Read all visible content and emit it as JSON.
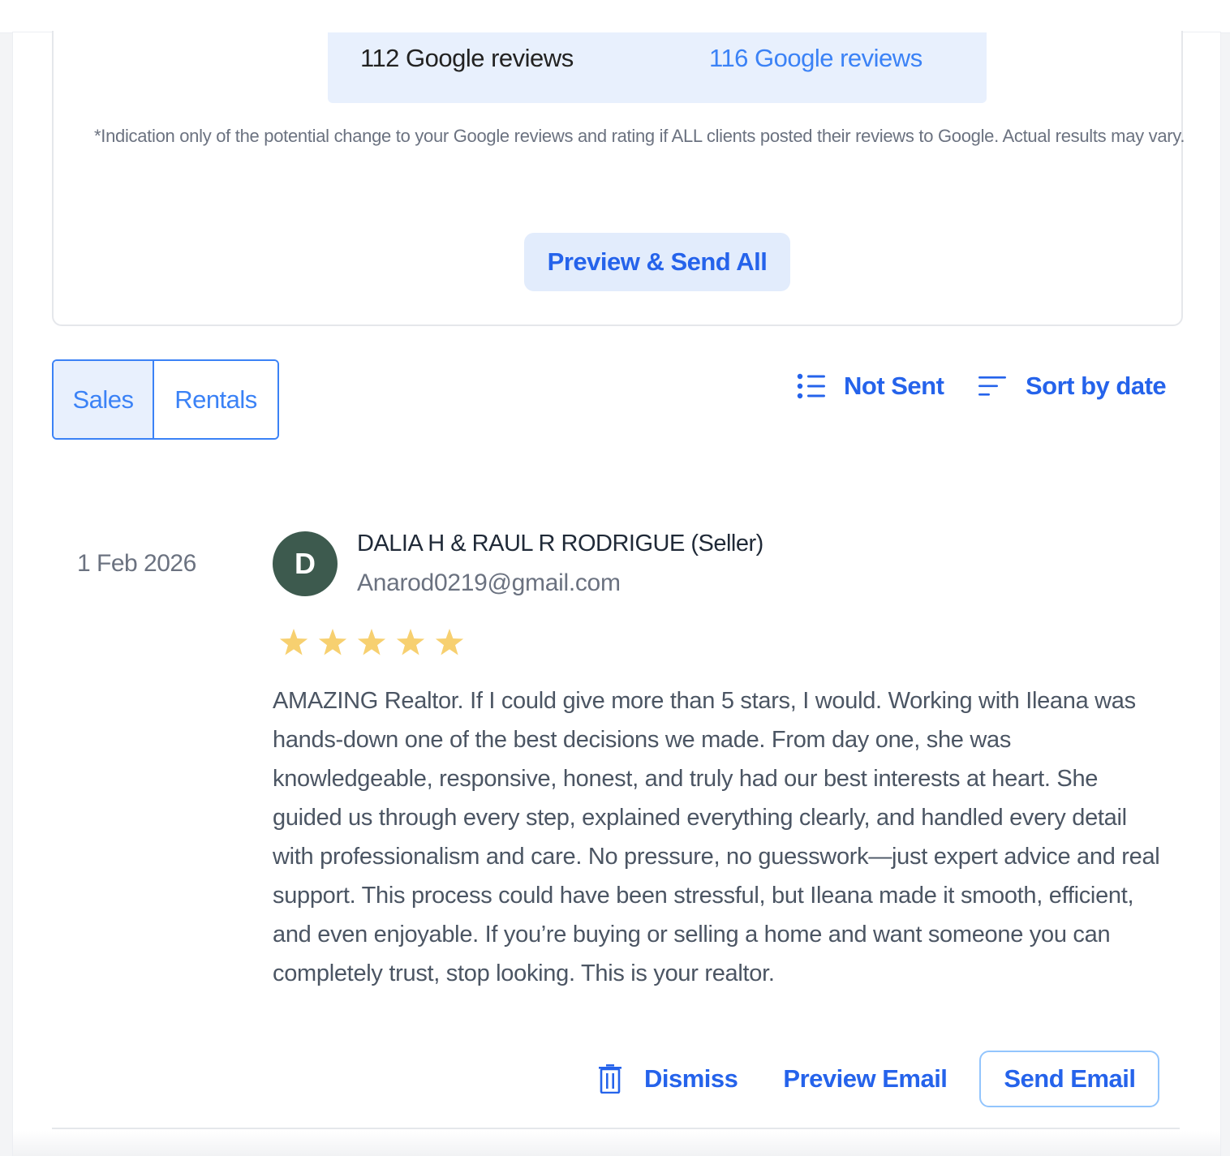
{
  "summary": {
    "current_reviews": "112 Google reviews",
    "potential_reviews": "116 Google reviews",
    "disclaimer": "*Indication only of the potential change to your Google reviews and rating if ALL clients posted their reviews to Google. Actual results may vary.",
    "preview_send_all_label": "Preview & Send All"
  },
  "tabs": {
    "items": [
      {
        "label": "Sales",
        "active": true
      },
      {
        "label": "Rentals",
        "active": false
      }
    ]
  },
  "filters": {
    "status_label": "Not Sent",
    "status_icon": "list-icon",
    "sort_label": "Sort by date",
    "sort_icon": "sort-icon"
  },
  "review": {
    "date": "1 Feb 2026",
    "avatar_initial": "D",
    "avatar_color": "#3d5a4e",
    "name": "DALIA H & RAUL R RODRIGUE (Seller)",
    "email": "Anarod0219@gmail.com",
    "rating": 5,
    "rating_max": 5,
    "star_color": "#f7d070",
    "text": "AMAZING Realtor. If I could give more than 5 stars, I would. Working with Ileana was hands-down one of the best decisions we made. From day one, she was knowledgeable, responsive, honest, and truly had our best interests at heart. She guided us through every step, explained everything clearly, and handled every detail with professionalism and care. No pressure, no guesswork—just expert advice and real support. This process could have been stressful, but Ileana made it smooth, efficient, and even enjoyable. If you’re buying or selling a home and want someone you can completely trust, stop looking. This is your realtor.",
    "actions": {
      "dismiss_label": "Dismiss",
      "dismiss_icon": "trash-icon",
      "preview_label": "Preview Email",
      "send_label": "Send Email"
    }
  },
  "colors": {
    "accent": "#2563eb",
    "accent_light": "#3b82f6",
    "band_bg": "#e8f0fd"
  }
}
